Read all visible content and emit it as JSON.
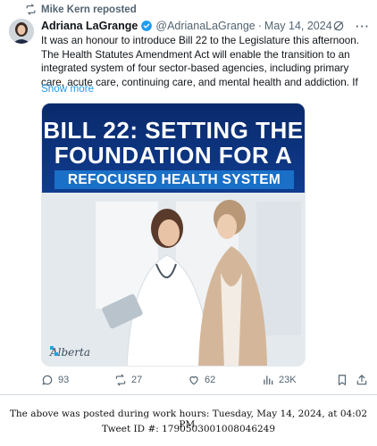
{
  "repost": {
    "text": "Mike Kern reposted"
  },
  "tweet": {
    "author_name": "Adriana LaGrange",
    "handle": "@AdrianaLaGrange",
    "separator": "·",
    "date": "May 14, 2024",
    "body": "It was an honour to introduce Bill 22 to the Legislature this afternoon. The Health Statutes Amendment Act will enable the transition to an integrated system of four sector-based agencies, including primary care, acute care, continuing care, and mental health and addiction. If",
    "show_more": "Show more"
  },
  "media": {
    "headline_line1": "BILL 22: SETTING THE",
    "headline_line2": "FOUNDATION FOR A",
    "subheadline": "REFOCUSED HEALTH SYSTEM",
    "logo_text": "Alberta"
  },
  "actions": {
    "replies": "93",
    "reposts": "27",
    "likes": "62",
    "views": "23K"
  },
  "footer": {
    "work_hours_note": "The above was posted during work hours: Tuesday, May 14, 2024, at 04:02 PM.",
    "tweet_id": "Tweet ID #: 1790503001008046249"
  },
  "colors": {
    "link_blue": "#1d9bf0",
    "muted_gray": "#536471",
    "banner_navy": "#0f3c8f",
    "subheadline_blue": "#1a6fc7"
  },
  "icons": [
    "repost-icon",
    "verified-badge-icon",
    "grok-icon",
    "more-icon",
    "reply-icon",
    "retweet-icon",
    "like-icon",
    "views-icon",
    "bookmark-icon",
    "share-icon"
  ]
}
